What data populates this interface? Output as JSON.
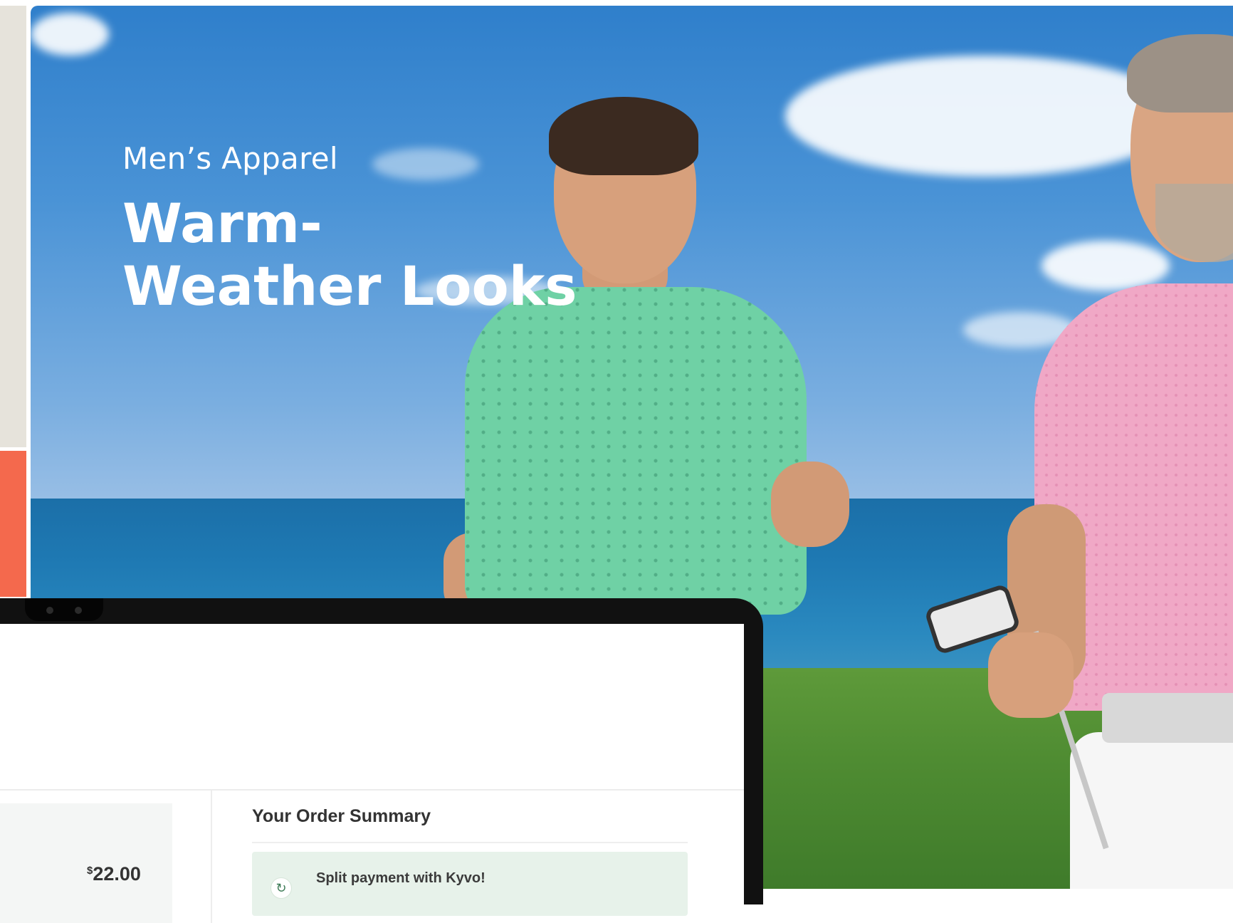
{
  "hero": {
    "eyebrow": "Men’s Apparel",
    "title": "Warm-Weather Looks"
  },
  "checkout": {
    "price_currency": "$",
    "price_value": "22.00",
    "summary_title": "Your Order Summary",
    "split_payment_text": "Split payment with Kyvo!",
    "split_icon": "refresh-icon"
  },
  "colors": {
    "accent_orange": "#f4694d",
    "panel_beige": "#e6e3db",
    "split_box_bg": "#e7f2ea"
  }
}
